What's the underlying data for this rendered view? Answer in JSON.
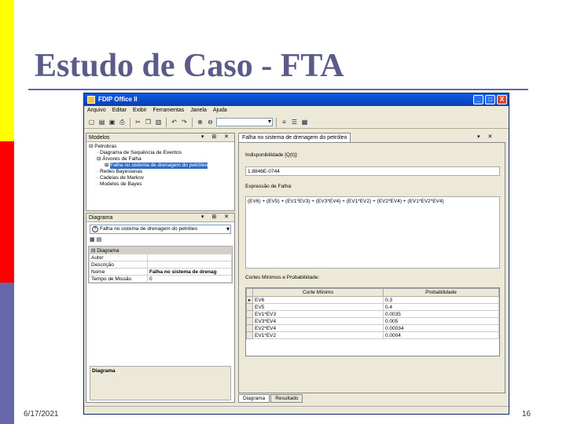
{
  "slide": {
    "title": "Estudo de Caso - FTA",
    "date": "6/17/2021",
    "page": "16",
    "colors": {
      "yellow": "#ffff00",
      "red": "#ff0000",
      "blue": "#6666aa"
    }
  },
  "window": {
    "title": "FDIP Office II",
    "controls": [
      "_",
      "□",
      "X"
    ],
    "menu": [
      "Arquivo",
      "Editar",
      "Exibir",
      "Ferramentas",
      "Janela",
      "Ajuda"
    ],
    "toolbar_icons": [
      "new-icon",
      "open-icon",
      "save-icon",
      "print-icon",
      "cut-icon",
      "copy-icon",
      "paste-icon",
      "undo-icon",
      "redo-icon",
      "zoom-in-icon",
      "zoom-out-icon"
    ]
  },
  "models_panel": {
    "title": "Modelos",
    "tree": [
      {
        "label": "Petrobras",
        "level": 0
      },
      {
        "label": "Diagrama de Sequência de Eventos",
        "level": 1
      },
      {
        "label": "Árvores de Falha",
        "level": 1
      },
      {
        "label": "Falha no sistema de drenagem do petróleo",
        "level": 2,
        "selected": true
      },
      {
        "label": "Redes Bayesianas",
        "level": 1
      },
      {
        "label": "Cadeias de Markov",
        "level": 1
      },
      {
        "label": "Modelos de Bayes",
        "level": 1
      }
    ]
  },
  "diagram_panel": {
    "title": "Diagrama",
    "selected": "Falha no sistema de drenagem do petróleo",
    "category": "Diagrama",
    "properties": [
      {
        "name": "Autor",
        "value": ""
      },
      {
        "name": "Descrição",
        "value": ""
      },
      {
        "name": "Nome",
        "value": "Falha no sistema de drenag"
      },
      {
        "name": "Tempo de Missão",
        "value": "0"
      }
    ],
    "footer_label": "Diagrama"
  },
  "document": {
    "tab": "Falha no sistema de drenagem do petróleo",
    "probability_label": "Indisponibilidade [Q(t)]:",
    "probability_value": "1.8846E-0744",
    "expression_label": "Expressão de Falha:",
    "expression_value": "(EV6) + (EV5) + (EV1*EV3) + (EV3*EV4) + (EV1*EV2) + (EV2*EV4) + (EV1*EV2*EV4)",
    "cutsets_label": "Cortes Mínimos e Probabilidade:",
    "columns": [
      "Corte Mínimo",
      "Probabilidade"
    ],
    "rows": [
      {
        "cut": "EV6",
        "prob": "0.3"
      },
      {
        "cut": "EV5",
        "prob": "0.4"
      },
      {
        "cut": "EV1*EV3",
        "prob": "0.0035"
      },
      {
        "cut": "EV3*EV4",
        "prob": "0.005"
      },
      {
        "cut": "EV2*EV4",
        "prob": "0.00034"
      },
      {
        "cut": "EV1*EV2",
        "prob": "0.0004"
      }
    ],
    "bottom_tabs": [
      "Diagrama",
      "Resultado"
    ]
  }
}
